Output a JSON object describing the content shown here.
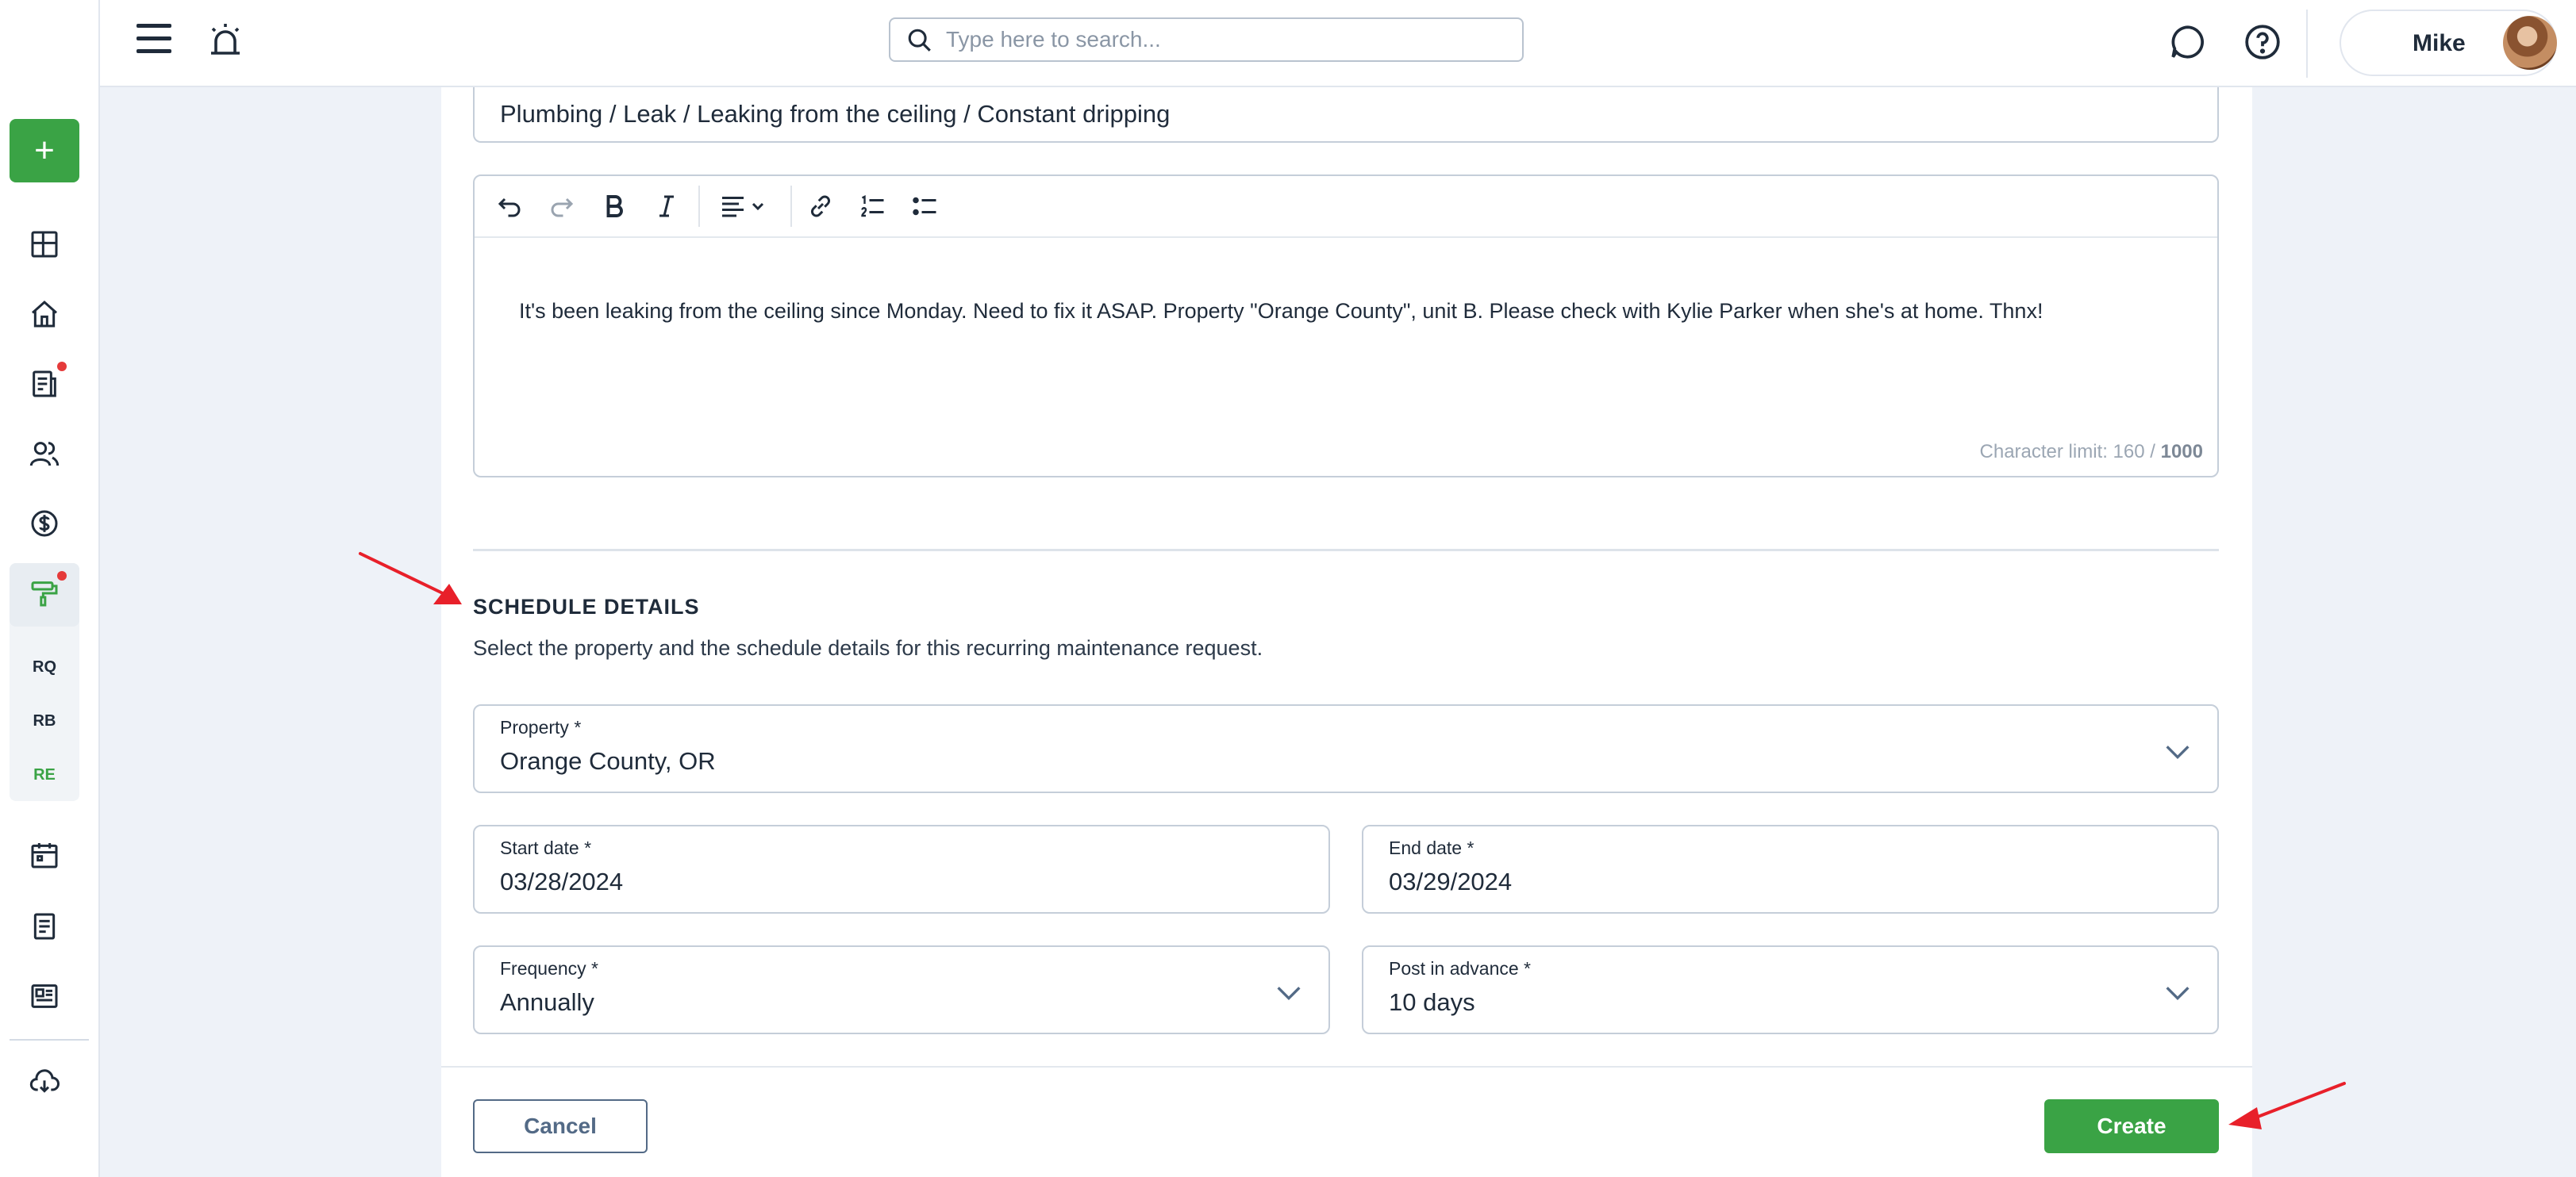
{
  "header": {
    "search_placeholder": "Type here to search...",
    "user_name": "Mike"
  },
  "sidebar": {
    "add_label": "+",
    "sub_items": [
      "RQ",
      "RB",
      "RE"
    ]
  },
  "request": {
    "title": "Plumbing / Leak / Leaking from the ceiling / Constant dripping",
    "description": "It's been leaking from the ceiling since Monday. Need to fix it ASAP. Property \"Orange County\", unit B. Please check with Kylie Parker when she's at home. Thnx!",
    "char_limit_prefix": "Character limit: 160 / ",
    "char_limit_max": "1000"
  },
  "schedule": {
    "title": "SCHEDULE DETAILS",
    "description": "Select the property and the schedule details for this recurring maintenance request.",
    "property_label": "Property *",
    "property_value": "Orange County, OR",
    "start_label": "Start date *",
    "start_value": "03/28/2024",
    "end_label": "End date *",
    "end_value": "03/29/2024",
    "frequency_label": "Frequency *",
    "frequency_value": "Annually",
    "advance_label": "Post in advance *",
    "advance_value": "10 days"
  },
  "footer": {
    "cancel_label": "Cancel",
    "create_label": "Create"
  },
  "colors": {
    "primary_green": "#3aa345",
    "annotation_red": "#e8202a",
    "notification_dot": "#e53a3a"
  }
}
